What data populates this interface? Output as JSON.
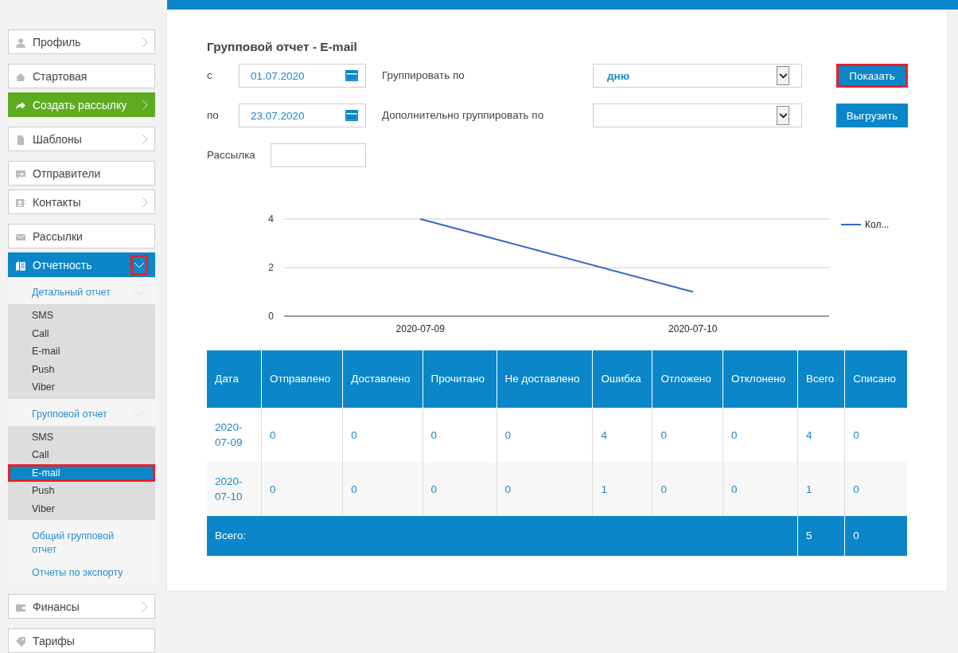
{
  "sidebar": {
    "groups": [
      [
        {
          "label": "Профиль",
          "kind": "item",
          "expanded": false,
          "highlighted": false
        }
      ],
      [
        {
          "label": "Стартовая",
          "kind": "item",
          "highlighted": false
        },
        {
          "label": "Создать рассылку",
          "kind": "action",
          "expanded": false,
          "highlighted": false
        }
      ],
      [
        {
          "label": "Шаблоны",
          "kind": "item",
          "expanded": false,
          "highlighted": false
        }
      ],
      [
        {
          "label": "Отправители",
          "kind": "item",
          "highlighted": false
        },
        {
          "label": "Контакты",
          "kind": "item",
          "expanded": false,
          "highlighted": false
        }
      ],
      [
        {
          "label": "Рассылки",
          "kind": "item",
          "highlighted": false
        },
        {
          "label": "Отчетность",
          "kind": "active",
          "highlighted": true,
          "expanded": true,
          "submenu": [
            {
              "kind": "section",
              "label": "Детальный отчет",
              "children": [
                {
                  "label": "SMS",
                  "selected": false,
                  "highlighted": false
                },
                {
                  "label": "Call",
                  "selected": false,
                  "highlighted": false
                },
                {
                  "label": "E-mail",
                  "selected": false,
                  "highlighted": false
                },
                {
                  "label": "Push",
                  "selected": false,
                  "highlighted": false
                },
                {
                  "label": "Viber",
                  "selected": false,
                  "highlighted": false
                }
              ]
            },
            {
              "kind": "section",
              "label": "Групповой отчет",
              "children": [
                {
                  "label": "SMS",
                  "selected": false,
                  "highlighted": false
                },
                {
                  "label": "Call",
                  "selected": false,
                  "highlighted": false
                },
                {
                  "label": "E-mail",
                  "selected": true,
                  "highlighted": true
                },
                {
                  "label": "Push",
                  "selected": false,
                  "highlighted": false
                },
                {
                  "label": "Viber",
                  "selected": false,
                  "highlighted": false
                }
              ]
            },
            {
              "kind": "link",
              "label": "Общий групповой отчет"
            },
            {
              "kind": "link",
              "label": "Отчеты по экспорту"
            }
          ]
        }
      ],
      [
        {
          "label": "Финансы",
          "kind": "item",
          "expanded": false,
          "highlighted": false
        }
      ],
      [
        {
          "label": "Тарифы",
          "kind": "item",
          "highlighted": false
        }
      ]
    ]
  },
  "report": {
    "title": "Групповой отчет - E-mail",
    "from": {
      "label": "с",
      "value": "01.07.2020"
    },
    "to": {
      "label": "по",
      "value": "23.07.2020"
    },
    "group_by": {
      "label": "Группировать по",
      "value": "дню"
    },
    "group_by_extra": {
      "label": "Дополнительно группировать по"
    },
    "mailing": {
      "label": "Рассылка"
    },
    "show_button": {
      "label": "Показать",
      "highlighted": true
    },
    "export_button": {
      "label": "Выгрузить",
      "highlighted": false
    },
    "chart_data": {
      "type": "line",
      "categories": [
        "2020-07-09",
        "2020-07-10"
      ],
      "series": [
        {
          "name": "Кол...",
          "color": "#3366cc",
          "values": [
            4,
            1
          ]
        }
      ],
      "ylim": [
        0,
        4
      ],
      "yticks": [
        0,
        2,
        4
      ]
    },
    "table": {
      "columns": [
        "Дата",
        "Отправлено",
        "Доставлено",
        "Прочитано",
        "Не доставлено",
        "Ошибка",
        "Отложено",
        "Отклонено",
        "Всего",
        "Списано"
      ],
      "rows": [
        [
          "2020-07-09",
          "0",
          "0",
          "0",
          "0",
          "4",
          "0",
          "0",
          "4",
          "0"
        ],
        [
          "2020-07-10",
          "0",
          "0",
          "0",
          "0",
          "1",
          "0",
          "0",
          "1",
          "0"
        ]
      ],
      "footer": {
        "label": "Всего:",
        "total": "5",
        "charged": "0"
      }
    }
  }
}
